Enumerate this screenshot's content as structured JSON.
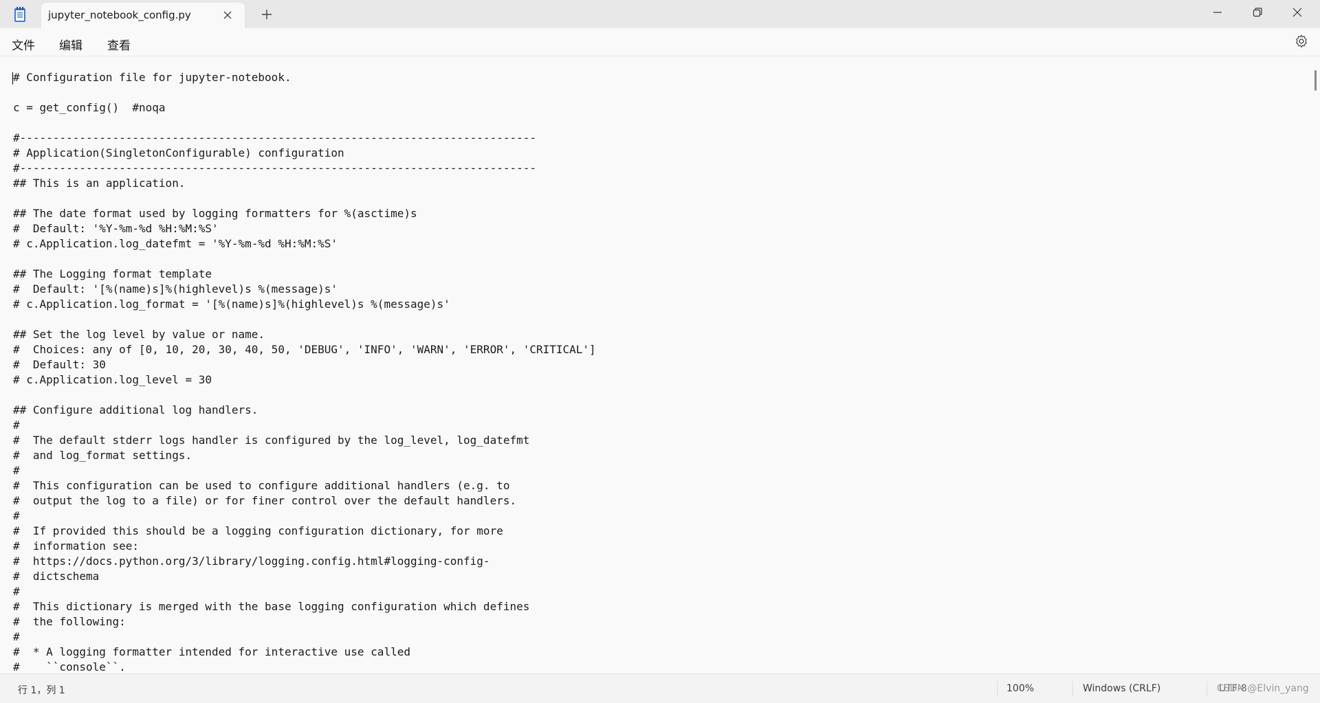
{
  "window": {
    "tab_title": "jupyter_notebook_config.py",
    "new_tab_symbol": "+"
  },
  "menu": {
    "items": [
      "文件",
      "编辑",
      "查看"
    ]
  },
  "editor": {
    "lines": [
      "# Configuration file for jupyter-notebook.",
      "",
      "c = get_config()  #noqa",
      "",
      "#------------------------------------------------------------------------------",
      "# Application(SingletonConfigurable) configuration",
      "#------------------------------------------------------------------------------",
      "## This is an application.",
      "",
      "## The date format used by logging formatters for %(asctime)s",
      "#  Default: '%Y-%m-%d %H:%M:%S'",
      "# c.Application.log_datefmt = '%Y-%m-%d %H:%M:%S'",
      "",
      "## The Logging format template",
      "#  Default: '[%(name)s]%(highlevel)s %(message)s'",
      "# c.Application.log_format = '[%(name)s]%(highlevel)s %(message)s'",
      "",
      "## Set the log level by value or name.",
      "#  Choices: any of [0, 10, 20, 30, 40, 50, 'DEBUG', 'INFO', 'WARN', 'ERROR', 'CRITICAL']",
      "#  Default: 30",
      "# c.Application.log_level = 30",
      "",
      "## Configure additional log handlers.",
      "#",
      "#  The default stderr logs handler is configured by the log_level, log_datefmt",
      "#  and log_format settings.",
      "#",
      "#  This configuration can be used to configure additional handlers (e.g. to",
      "#  output the log to a file) or for finer control over the default handlers.",
      "#",
      "#  If provided this should be a logging configuration dictionary, for more",
      "#  information see:",
      "#  https://docs.python.org/3/library/logging.config.html#logging-config-",
      "#  dictschema",
      "#",
      "#  This dictionary is merged with the base logging configuration which defines",
      "#  the following:",
      "#",
      "#  * A logging formatter intended for interactive use called",
      "#    ``console``."
    ]
  },
  "status": {
    "position": "行 1，列 1",
    "zoom": "100%",
    "line_ending": "Windows (CRLF)",
    "encoding": "UTF-8",
    "watermark": "CSDN @Elvin_yang"
  },
  "icons": {
    "app": "notepad-icon",
    "close_tab": "close-icon",
    "add_tab": "plus-icon",
    "minimize": "minimize-icon",
    "restore": "restore-icon",
    "close_window": "close-icon",
    "settings": "gear-icon"
  }
}
